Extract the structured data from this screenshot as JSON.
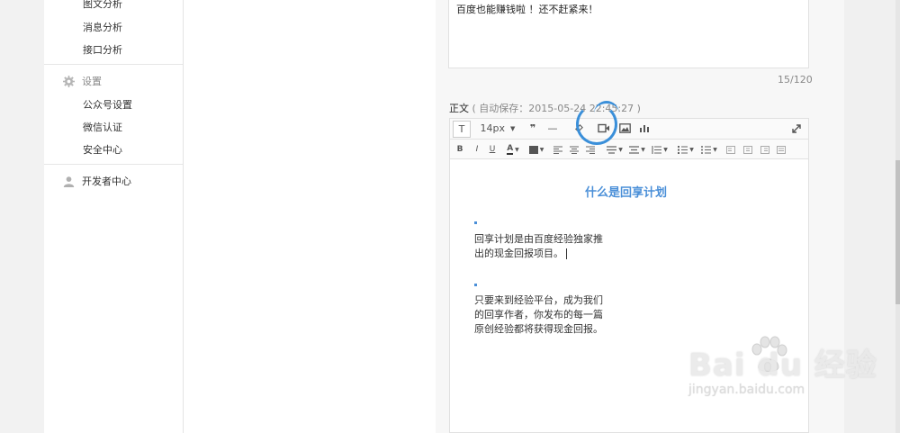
{
  "sidebar": {
    "items_top": [
      "图文分析",
      "消息分析",
      "接口分析"
    ],
    "settings_group": "设置",
    "settings_items": [
      "公众号设置",
      "微信认证",
      "安全中心"
    ],
    "developer_group": "开发者中心"
  },
  "editor": {
    "title_text": "百度也能赚钱啦 ！还不赶紧来！",
    "counter": "15/120",
    "body_label": "正文",
    "autosave": "( 自动保存：2015-05-24 22:45:27 )",
    "toolbar": {
      "font_size": "14px",
      "text_icon": "T",
      "quote_icon": "❞",
      "hr_icon": "—",
      "video_icon": "video-icon",
      "image_icon": "image-icon",
      "chart_icon": "chart-icon",
      "expand_icon": "expand-icon"
    },
    "toolbar2": {
      "bold": "B",
      "italic": "I",
      "underline": "U"
    },
    "content": {
      "heading": "什么是回享计划",
      "para1_line1": "回享计划是由百度经验独家推",
      "para1_line2": "出的现金回报项目。",
      "para2_line1": "只要来到经验平台，成为我们",
      "para2_line2": "的回享作者，你发布的每一篇",
      "para2_line3": "原创经验都将获得现金回报。"
    }
  },
  "watermark": {
    "brand": "Bai du 经验",
    "url": "jingyan.baidu.com"
  },
  "colors": {
    "accent": "#4a8fd8",
    "annotation": "#3a8fd9"
  }
}
